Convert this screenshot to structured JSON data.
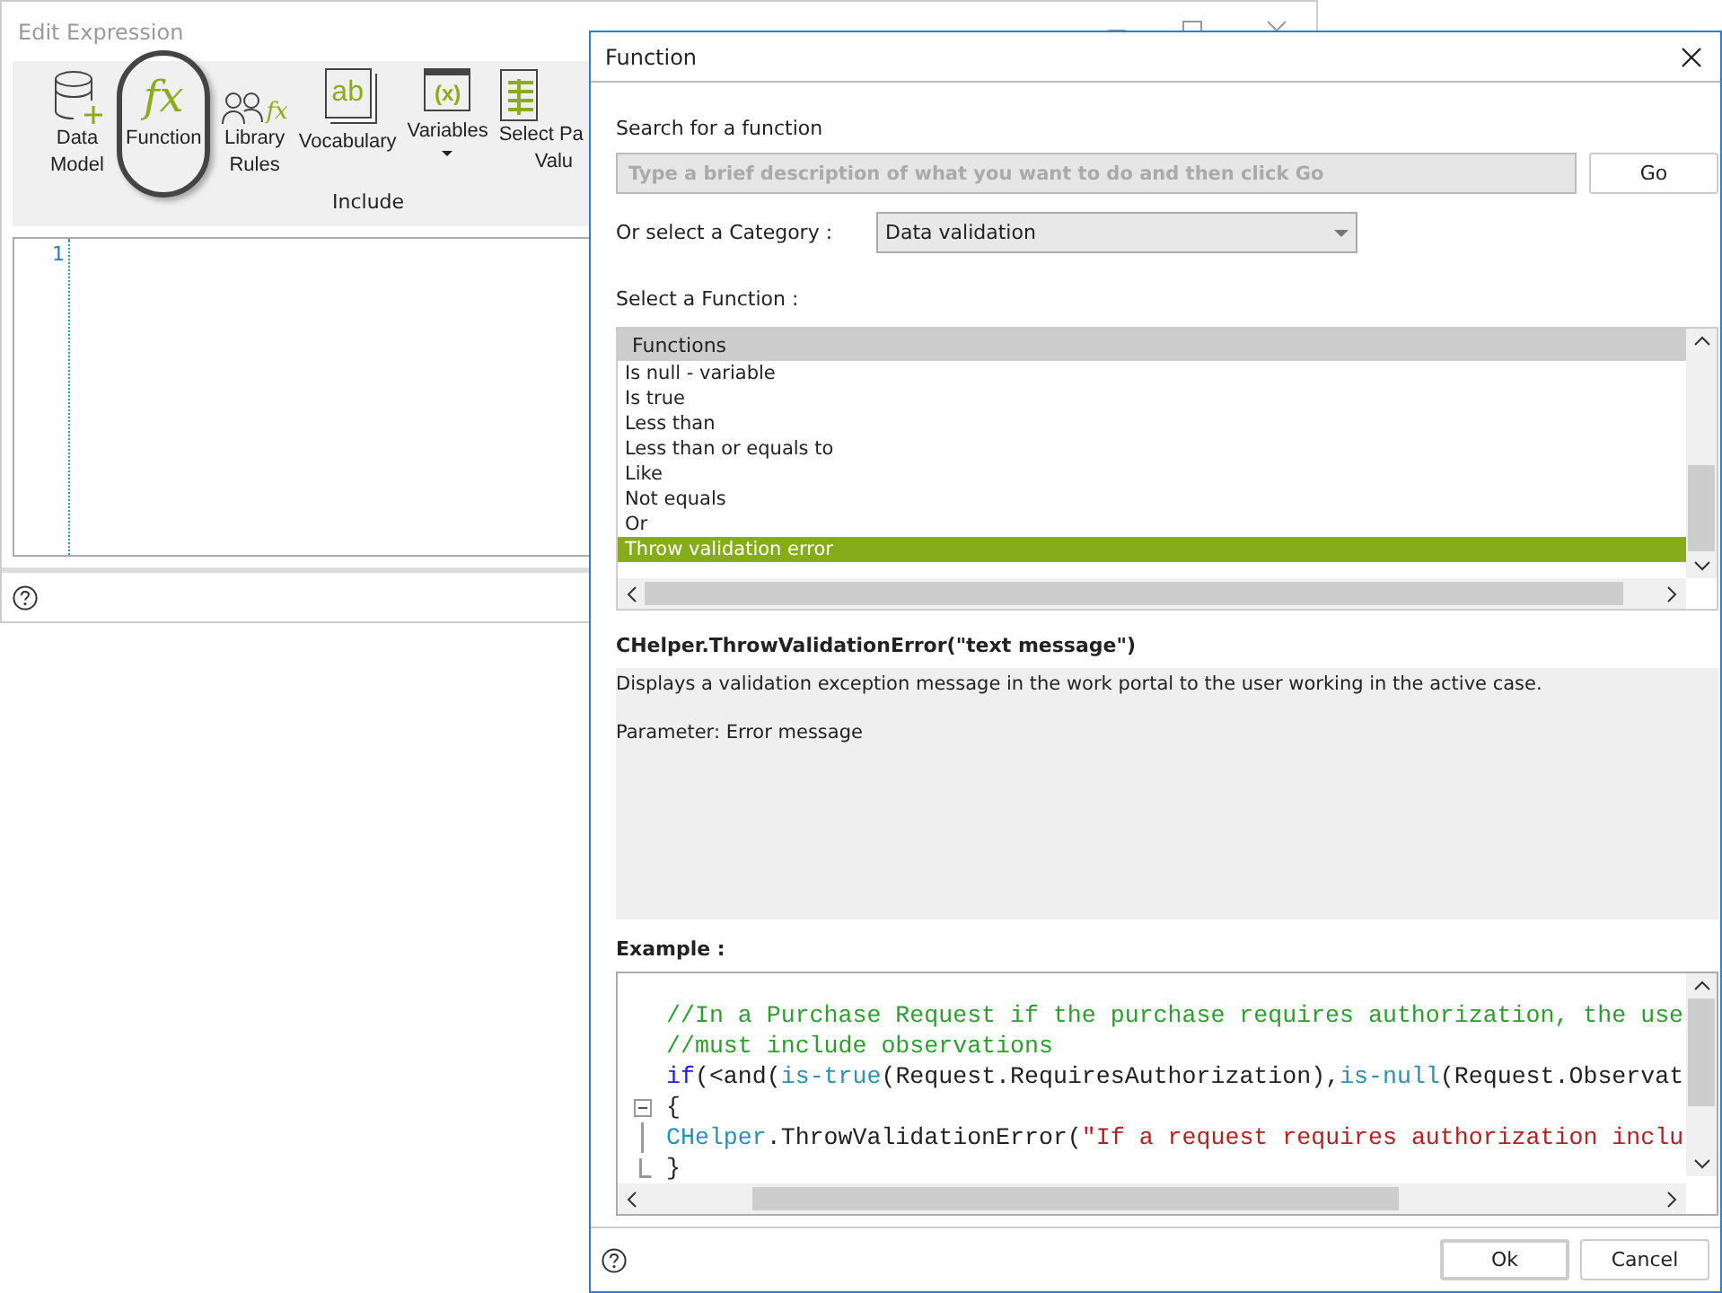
{
  "main_window": {
    "title": "Edit Expression",
    "ribbon": {
      "items": [
        {
          "kind": "database",
          "label": [
            "Data",
            "Model"
          ],
          "circled": false,
          "dropdown": false
        },
        {
          "kind": "fx",
          "glyph": "fx",
          "label": [
            "Function"
          ],
          "circled": true,
          "dropdown": false
        },
        {
          "kind": "people-fx",
          "glyph": "fx",
          "label": [
            "Library",
            "Rules"
          ],
          "circled": false,
          "dropdown": false
        },
        {
          "kind": "notebook",
          "glyph": "ab",
          "label": [
            "Vocabulary"
          ],
          "circled": false,
          "dropdown": false
        },
        {
          "kind": "variable",
          "glyph": "(x)",
          "label": [
            "Variables"
          ],
          "circled": false,
          "dropdown": true
        },
        {
          "kind": "table",
          "label": [
            "Select Pa",
            "Valu"
          ],
          "circled": false,
          "dropdown": false
        }
      ],
      "group_label": "Include"
    },
    "editor": {
      "line_numbers": [
        "1"
      ]
    }
  },
  "dialog": {
    "title": "Function",
    "search": {
      "label": "Search for a function",
      "placeholder": "Type a brief description of what you want to do and then click Go",
      "button": "Go"
    },
    "category": {
      "label": "Or select a Category :",
      "value": "Data validation"
    },
    "function_list": {
      "label": "Select a Function :",
      "header": "Functions",
      "items": [
        {
          "label": "Is null - variable",
          "selected": false
        },
        {
          "label": "Is true",
          "selected": false
        },
        {
          "label": "Less than",
          "selected": false
        },
        {
          "label": "Less than or equals to",
          "selected": false
        },
        {
          "label": "Like",
          "selected": false
        },
        {
          "label": "Not equals",
          "selected": false
        },
        {
          "label": "Or",
          "selected": false
        },
        {
          "label": "Throw validation error",
          "selected": true
        }
      ]
    },
    "signature": "CHelper.ThrowValidationError(\"text message\")",
    "description": [
      "Displays a validation exception message in the work portal to the user working in the active case.",
      "Parameter: Error message"
    ],
    "example": {
      "label": "Example :",
      "lines": [
        {
          "kind": "plain",
          "tokens": [
            {
              "kind": "comment",
              "text": "//In a Purchase Request if the purchase requires authorization, the use"
            }
          ]
        },
        {
          "kind": "plain",
          "tokens": [
            {
              "kind": "comment",
              "text": "//must include observations"
            }
          ]
        },
        {
          "kind": "plain",
          "tokens": [
            {
              "kind": "keyword",
              "text": "if"
            },
            {
              "kind": "plain",
              "text": "(<and("
            },
            {
              "kind": "func",
              "text": "is-true"
            },
            {
              "kind": "plain",
              "text": "(Request.RequiresAuthorization),"
            },
            {
              "kind": "func",
              "text": "is-null"
            },
            {
              "kind": "plain",
              "text": "(Request.Observat"
            }
          ]
        },
        {
          "kind": "fold-start",
          "tokens": [
            {
              "kind": "plain",
              "text": "{"
            }
          ]
        },
        {
          "kind": "fold-mid",
          "tokens": [
            {
              "kind": "func",
              "text": "CHelper"
            },
            {
              "kind": "plain",
              "text": ".ThrowValidationError("
            },
            {
              "kind": "string",
              "text": "\"If a request requires authorization inclu"
            }
          ]
        },
        {
          "kind": "fold-end",
          "tokens": [
            {
              "kind": "plain",
              "text": "}"
            }
          ]
        }
      ]
    },
    "buttons": [
      "Ok",
      "Cancel"
    ]
  }
}
